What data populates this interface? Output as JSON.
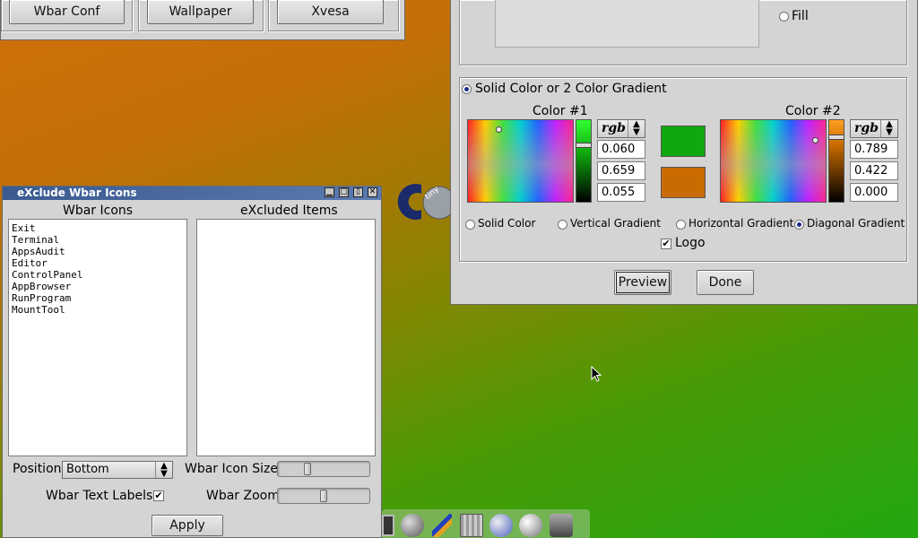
{
  "top_left_window": {
    "buttons": [
      "Wbar Conf",
      "Wallpaper",
      "Xvesa"
    ]
  },
  "color_window": {
    "fill_label": "Fill",
    "gradient_group_label": "Solid Color or 2 Color Gradient",
    "color1": {
      "title": "Color #1",
      "mode": "rgb",
      "r": "0.060",
      "g": "0.659",
      "b": "0.055",
      "swatch": "#0fa80e"
    },
    "color2": {
      "title": "Color #2",
      "mode": "rgb",
      "r": "0.789",
      "g": "0.422",
      "b": "0.000",
      "swatch": "#c96b00"
    },
    "gradient_options": [
      "Solid Color",
      "Vertical Gradient",
      "Horizontal Gradient",
      "Diagonal Gradient"
    ],
    "selected_gradient": "Diagonal Gradient",
    "logo_label": "Logo",
    "logo_checked": true,
    "preview_label": "Preview",
    "done_label": "Done"
  },
  "exclude_window": {
    "title": "eXclude Wbar Icons",
    "wbar_icons_header": "Wbar Icons",
    "excluded_header": "eXcluded Items",
    "wbar_icons": [
      "Exit",
      "Terminal",
      "AppsAudit",
      "Editor",
      "ControlPanel",
      "AppBrowser",
      "RunProgram",
      "MountTool"
    ],
    "excluded_items": [],
    "position_label": "Position",
    "position_value": "Bottom",
    "icon_size_label": "Wbar Icon Size",
    "text_labels_label": "Wbar Text Labels",
    "text_labels_checked": true,
    "zoom_label": "Wbar Zoom",
    "apply_label": "Apply"
  },
  "colors": {
    "panel_bg": "#d4d4d4",
    "titlebar": "#4a6aa0",
    "desktop_top": "#d2700a",
    "desktop_bottom": "#22a810"
  }
}
